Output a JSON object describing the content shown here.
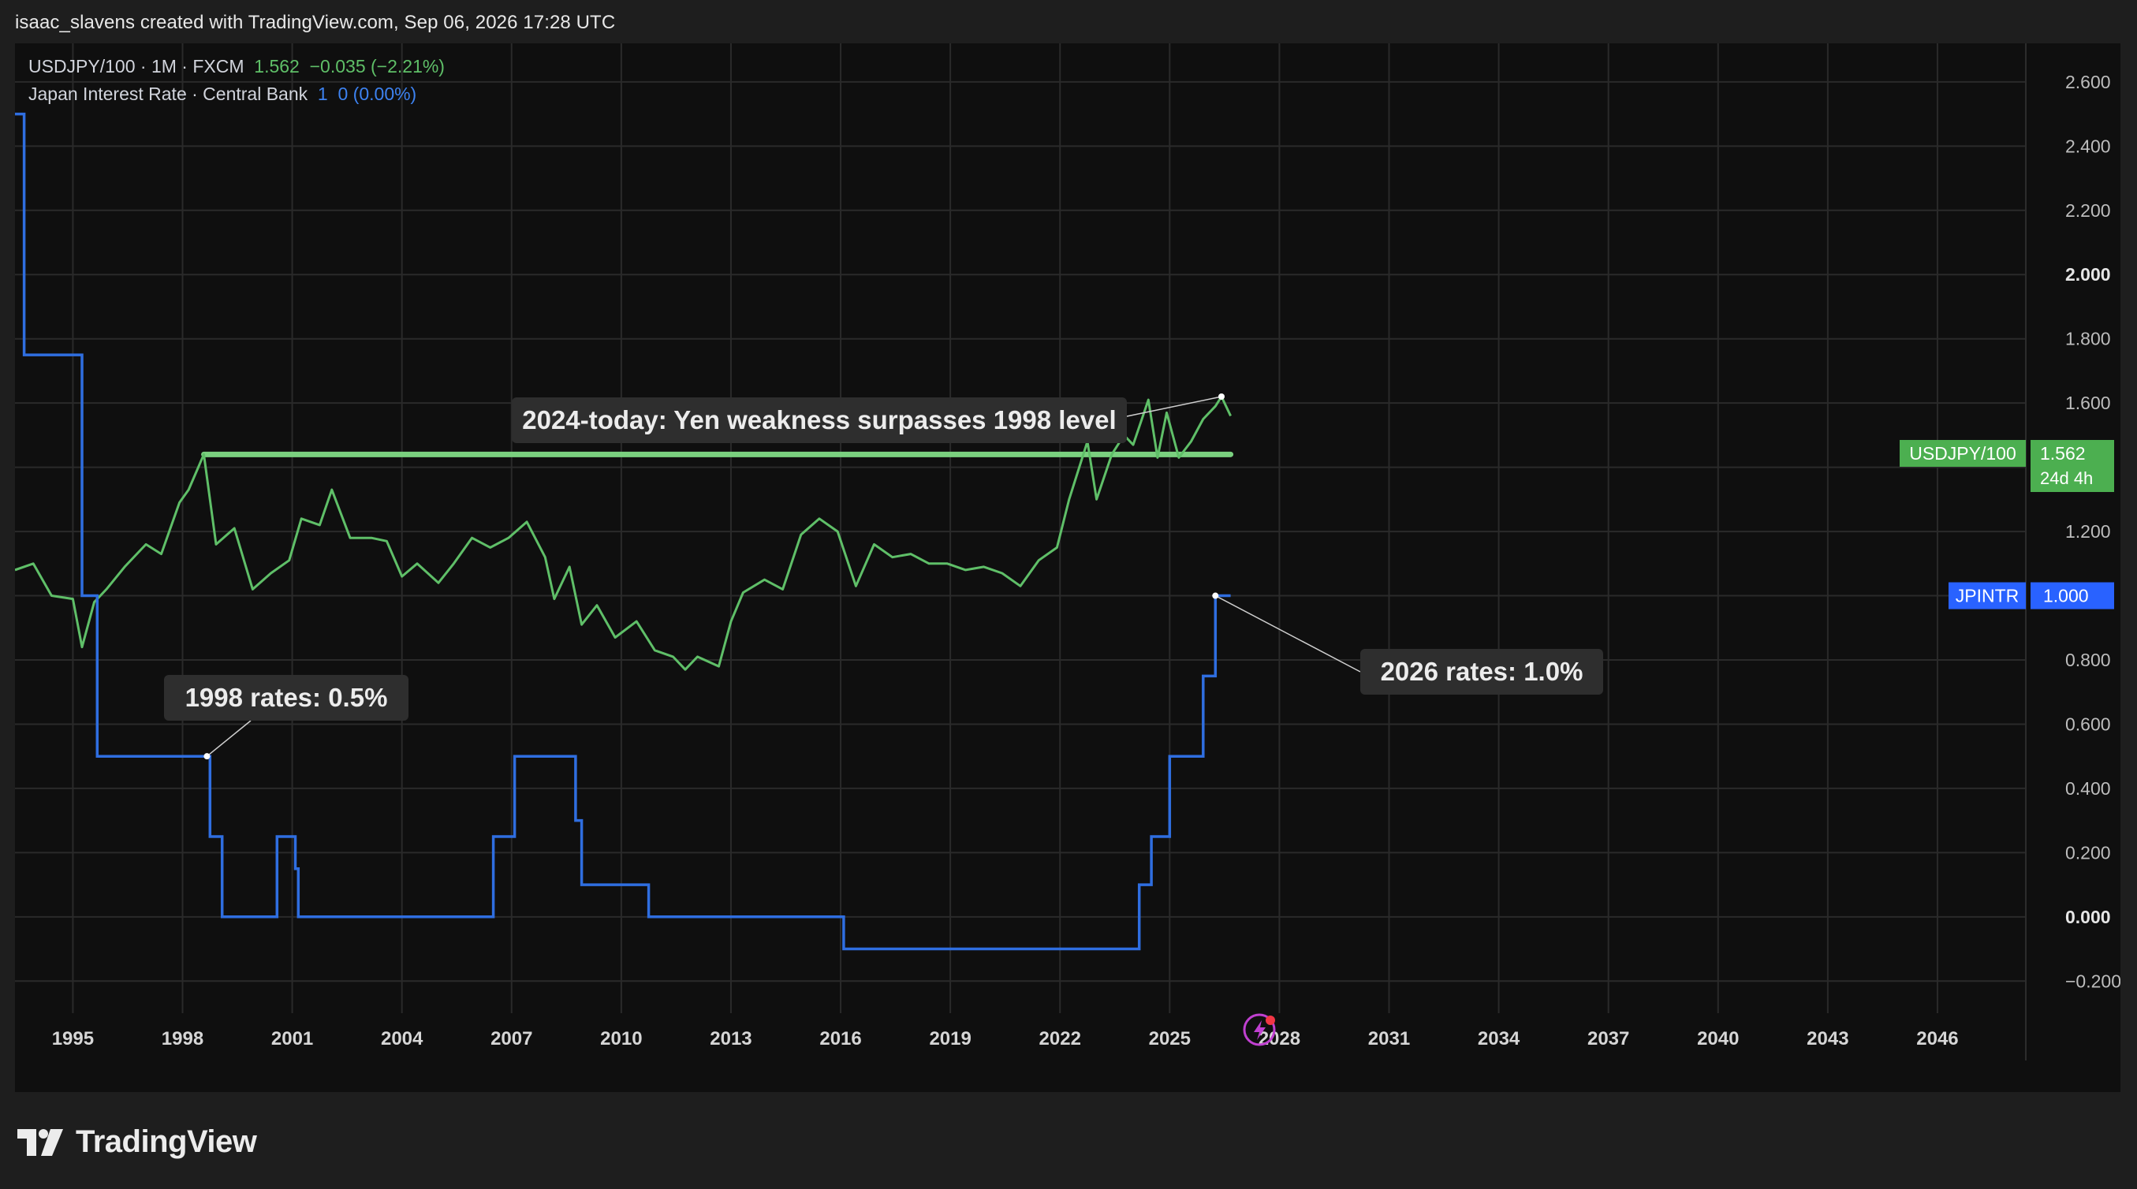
{
  "header": {
    "credit": "isaac_slavens created with TradingView.com, Sep 06, 2026 17:28 UTC"
  },
  "legend": {
    "usdjpy": {
      "label": "USDJPY/100 · 1M · FXCM",
      "value": "1.562",
      "change": "−0.035 (−2.21%)"
    },
    "jpintr": {
      "label": "Japan Interest Rate · Central Bank",
      "value": "1",
      "change": "0 (0.00%)"
    }
  },
  "footer": {
    "logo_text": "TradingView"
  },
  "colors": {
    "usdjpy": "#5fbf68",
    "jpintr": "#2f6ee0",
    "grid": "#2a2a2a",
    "panel": "#0f0f0f",
    "callout_bg": "#2e2e2e"
  },
  "chart_data": {
    "type": "line",
    "x_axis": {
      "type": "date",
      "range": [
        "1993-06",
        "2048-06"
      ],
      "ticks": [
        "1995",
        "1998",
        "2001",
        "2004",
        "2007",
        "2010",
        "2013",
        "2016",
        "2019",
        "2022",
        "2025",
        "2028",
        "2031",
        "2034",
        "2037",
        "2040",
        "2043",
        "2046"
      ]
    },
    "y_axis": {
      "range": [
        -0.3,
        2.72
      ],
      "ticks": [
        "2.600",
        "2.400",
        "2.200",
        "2.000",
        "1.800",
        "1.600",
        "1.400",
        "1.200",
        "1.000",
        "0.800",
        "0.600",
        "0.400",
        "0.200",
        "0.000",
        "−0.200"
      ],
      "bold_ticks": [
        "2.000",
        "1.000",
        "0.000"
      ]
    },
    "grid": true,
    "series": [
      {
        "name": "USDJPY/100",
        "points": [
          [
            "1993-06",
            1.08
          ],
          [
            "1993-12",
            1.1
          ],
          [
            "1994-06",
            1.0
          ],
          [
            "1995-01",
            0.99
          ],
          [
            "1995-04",
            0.84
          ],
          [
            "1995-08",
            0.98
          ],
          [
            "1995-12",
            1.02
          ],
          [
            "1996-06",
            1.09
          ],
          [
            "1997-01",
            1.16
          ],
          [
            "1997-06",
            1.13
          ],
          [
            "1997-12",
            1.29
          ],
          [
            "1998-03",
            1.33
          ],
          [
            "1998-08",
            1.44
          ],
          [
            "1998-12",
            1.16
          ],
          [
            "1999-06",
            1.21
          ],
          [
            "1999-12",
            1.02
          ],
          [
            "2000-06",
            1.07
          ],
          [
            "2000-12",
            1.11
          ],
          [
            "2001-04",
            1.24
          ],
          [
            "2001-10",
            1.22
          ],
          [
            "2002-02",
            1.33
          ],
          [
            "2002-08",
            1.18
          ],
          [
            "2003-03",
            1.18
          ],
          [
            "2003-08",
            1.17
          ],
          [
            "2004-01",
            1.06
          ],
          [
            "2004-06",
            1.1
          ],
          [
            "2005-01",
            1.04
          ],
          [
            "2005-06",
            1.1
          ],
          [
            "2005-12",
            1.18
          ],
          [
            "2006-06",
            1.15
          ],
          [
            "2006-12",
            1.18
          ],
          [
            "2007-06",
            1.23
          ],
          [
            "2007-12",
            1.12
          ],
          [
            "2008-03",
            0.99
          ],
          [
            "2008-08",
            1.09
          ],
          [
            "2008-12",
            0.91
          ],
          [
            "2009-05",
            0.97
          ],
          [
            "2009-11",
            0.87
          ],
          [
            "2010-06",
            0.92
          ],
          [
            "2010-12",
            0.83
          ],
          [
            "2011-06",
            0.81
          ],
          [
            "2011-10",
            0.77
          ],
          [
            "2012-02",
            0.81
          ],
          [
            "2012-09",
            0.78
          ],
          [
            "2013-01",
            0.92
          ],
          [
            "2013-05",
            1.01
          ],
          [
            "2013-12",
            1.05
          ],
          [
            "2014-06",
            1.02
          ],
          [
            "2014-12",
            1.19
          ],
          [
            "2015-06",
            1.24
          ],
          [
            "2015-12",
            1.2
          ],
          [
            "2016-06",
            1.03
          ],
          [
            "2016-12",
            1.16
          ],
          [
            "2017-06",
            1.12
          ],
          [
            "2017-12",
            1.13
          ],
          [
            "2018-06",
            1.1
          ],
          [
            "2018-12",
            1.1
          ],
          [
            "2019-06",
            1.08
          ],
          [
            "2019-12",
            1.09
          ],
          [
            "2020-06",
            1.07
          ],
          [
            "2020-12",
            1.03
          ],
          [
            "2021-06",
            1.11
          ],
          [
            "2021-12",
            1.15
          ],
          [
            "2022-04",
            1.3
          ],
          [
            "2022-10",
            1.48
          ],
          [
            "2023-01",
            1.3
          ],
          [
            "2023-06",
            1.44
          ],
          [
            "2023-10",
            1.5
          ],
          [
            "2024-01",
            1.47
          ],
          [
            "2024-06",
            1.61
          ],
          [
            "2024-09",
            1.43
          ],
          [
            "2024-12",
            1.57
          ],
          [
            "2025-04",
            1.43
          ],
          [
            "2025-08",
            1.48
          ],
          [
            "2025-12",
            1.55
          ],
          [
            "2026-04",
            1.59
          ],
          [
            "2026-06",
            1.62
          ],
          [
            "2026-09",
            1.56
          ]
        ]
      },
      {
        "name": "Japan Interest Rate",
        "points": [
          [
            "1993-06",
            2.5
          ],
          [
            "1993-09",
            1.75
          ],
          [
            "1995-04",
            1.0
          ],
          [
            "1995-09",
            0.5
          ],
          [
            "1998-09",
            0.5
          ],
          [
            "1998-10",
            0.25
          ],
          [
            "1999-02",
            0.0
          ],
          [
            "2000-08",
            0.25
          ],
          [
            "2001-02",
            0.15
          ],
          [
            "2001-03",
            0.0
          ],
          [
            "2006-07",
            0.25
          ],
          [
            "2007-02",
            0.5
          ],
          [
            "2008-10",
            0.3
          ],
          [
            "2008-12",
            0.1
          ],
          [
            "2010-10",
            0.0
          ],
          [
            "2016-01",
            0.0
          ],
          [
            "2016-02",
            -0.1
          ],
          [
            "2024-03",
            0.1
          ],
          [
            "2024-07",
            0.25
          ],
          [
            "2025-01",
            0.5
          ],
          [
            "2025-12",
            0.75
          ],
          [
            "2026-04",
            1.0
          ]
        ]
      }
    ],
    "horizontal_line": {
      "y": 1.44,
      "from": "1998-08",
      "to": "2026-09"
    },
    "annotations": [
      {
        "text": "2024-today: Yen weakness surpasses 1998 level",
        "target": [
          "2026-06",
          1.62
        ]
      },
      {
        "text": "1998 rates: 0.5%",
        "target": [
          "1998-09",
          0.5
        ]
      },
      {
        "text": "2026 rates: 1.0%",
        "target": [
          "2026-04",
          1.0
        ]
      }
    ],
    "price_labels": [
      {
        "name": "USDJPY/100",
        "value": "1.562",
        "extra": "24d 4h"
      },
      {
        "name": "JPINTR",
        "value": "1.000"
      }
    ]
  }
}
